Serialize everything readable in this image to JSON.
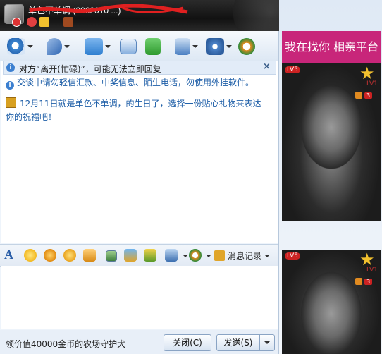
{
  "window": {
    "title_name": "单色不单调",
    "title_number": "(2062010",
    "title_suffix": "...)",
    "controls": {
      "minimize": "–",
      "maximize": "□",
      "close": "✕"
    }
  },
  "toolbar": {
    "items": [
      {
        "name": "video-chat",
        "icon": "camera-icon"
      },
      {
        "name": "voice-chat",
        "icon": "microphone-icon"
      },
      {
        "name": "send-file",
        "icon": "folder-icon"
      },
      {
        "name": "send-sms",
        "icon": "envelope-icon"
      },
      {
        "name": "create-group",
        "icon": "group-add-icon"
      },
      {
        "name": "remote-assist",
        "icon": "user-card-icon"
      },
      {
        "name": "app-settings",
        "icon": "gear-icon"
      },
      {
        "name": "soso",
        "icon": "s-logo-icon"
      }
    ]
  },
  "notice": {
    "text": "对方“离开(忙碌)”，可能无法立即回复",
    "close": "×"
  },
  "security_notice": "交谈中请勿轻信汇款、中奖信息、陌生电话，勿使用外挂软件。",
  "birthday_notice": "12月11日就是单色不单调，的生日了，选择一份贴心礼物来表达你的祝福吧！",
  "format_toolbar": {
    "font_label": "A",
    "message_log": "消息记录"
  },
  "bottom": {
    "ad_text": "领价值40000金币的农场守护犬",
    "close_button": "关闭(C)",
    "send_button": "发送(S)"
  },
  "side_panel": {
    "ad_banner": "我在找你 相亲平台",
    "badge_level": "LV5",
    "star_level": "LV1",
    "speaker_count": "3"
  },
  "colors": {
    "title_bar": "#1a1a1a",
    "accent_blue": "#1f5fa8",
    "ad_pink": "#c8267a"
  }
}
